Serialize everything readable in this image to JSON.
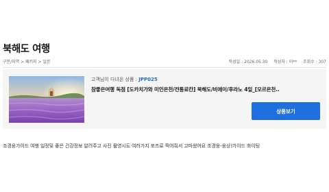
{
  "page": {
    "title": "북해도 여행"
  },
  "meta": {
    "breadcrumb": "구분/지역 > 패키지 > 일본",
    "date": "작성일 : 2026.05.30",
    "author": "작성자 : 이**",
    "views": "조회수 : 307"
  },
  "product": {
    "recent_label": "고객님이 다녀온 상품 :",
    "code": "JPP025",
    "title": "참좋은여행 독점 [도카치가와 미인온천/전통료칸] 북해도/비에이/후라노 4일_[모르온천..",
    "button_label": "상품보기"
  },
  "review": {
    "body": "조경웅가이드 여행 일정및 좋은 건강정보 알려주고 사진 촬영시도 여러가지 포즈로 찍어줘서 고마웠어요 조경웅-웅상)가이드 화이팅"
  },
  "colors": {
    "accent": "#1f6fe0",
    "code_text": "#2366d8",
    "card_background": "#f5f5f5"
  }
}
